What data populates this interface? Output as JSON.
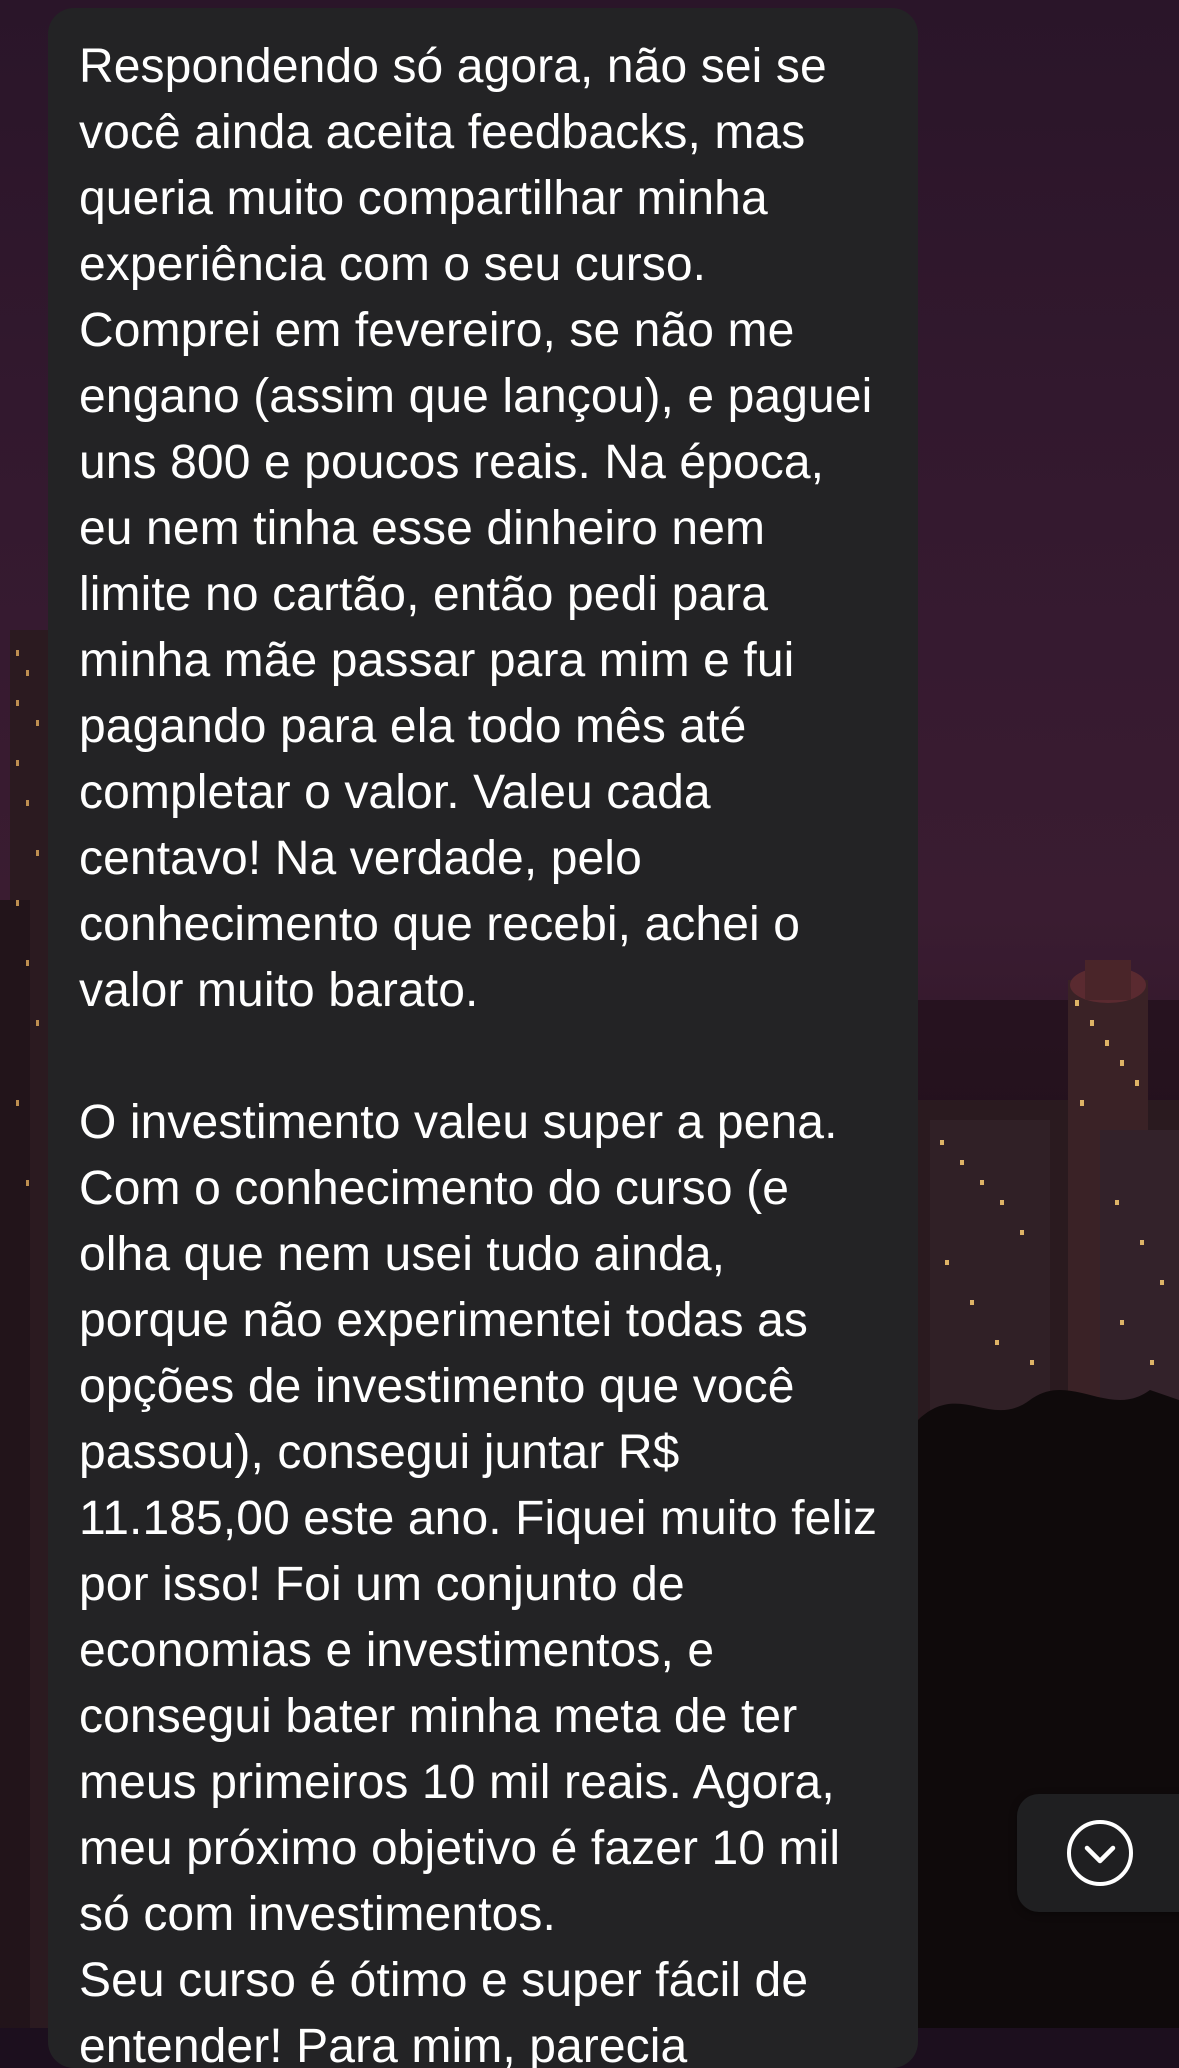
{
  "chat": {
    "message": {
      "paragraph_1": "Respondendo só agora, não sei se você ainda aceita feedbacks, mas queria muito compartilhar minha experiência com o seu curso. Comprei em fevereiro, se não me engano (assim que lançou), e paguei uns 800 e poucos reais. Na época, eu nem tinha esse dinheiro nem limite no cartão, então pedi para minha mãe passar para mim e fui pagando para ela todo mês até completar o valor. Valeu cada centavo! Na verdade, pelo conhecimento que recebi, achei o valor muito barato.",
      "paragraph_2": "O investimento valeu super a pena. Com o conhecimento do curso (e olha que nem usei tudo ainda, porque não experimentei todas as opções de investimento que você passou), consegui juntar R$ 11.185,00 este ano. Fiquei muito feliz por isso! Foi um conjunto de economias e investimentos, e consegui bater minha meta de ter meus primeiros 10 mil reais. Agora, meu próximo objetivo é fazer 10 mil só com investimentos.",
      "paragraph_3": "Seu curso é ótimo e super fácil de entender! Para mim, parecia"
    },
    "scroll_down_button": {
      "icon": "chevron-down-circle-icon"
    }
  },
  "colors": {
    "bubble_background": "#232325",
    "text": "#ffffff",
    "button_background": "#1f1f21"
  }
}
